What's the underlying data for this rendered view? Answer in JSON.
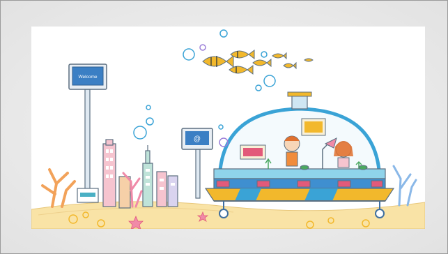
{
  "illustration": {
    "billboard_text": "Welcome",
    "screen_symbol": "@"
  },
  "palette": {
    "background": "#e6e6e6",
    "sand": "#f9e3a6",
    "dome": "#3aa3d6",
    "vehicle_body": "#3f8fd0",
    "fish": "#f2b82c"
  }
}
